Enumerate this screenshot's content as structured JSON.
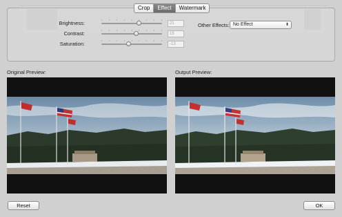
{
  "tabs": [
    {
      "label": "Crop",
      "active": false
    },
    {
      "label": "Effect",
      "active": true
    },
    {
      "label": "Watermark",
      "active": false
    }
  ],
  "adjustments": {
    "brightness": {
      "label": "Brightness:",
      "value": "21",
      "level": 0.61
    },
    "contrast": {
      "label": "Contrast:",
      "value": "15",
      "level": 0.57
    },
    "saturation": {
      "label": "Saturation:",
      "value": "-13",
      "level": 0.44
    }
  },
  "other_effects": {
    "label": "Other Effects:",
    "selected": "No Effect"
  },
  "original_preview": {
    "label": "Original Preview:"
  },
  "output_preview": {
    "label": "Output Preview:"
  },
  "buttons": {
    "reset": "Reset",
    "ok": "OK"
  },
  "icons": {
    "select_arrows": "up-down-chevron-icon"
  },
  "colors": {
    "window_bg": "#d0d0d0",
    "active_tab": "#777777"
  }
}
